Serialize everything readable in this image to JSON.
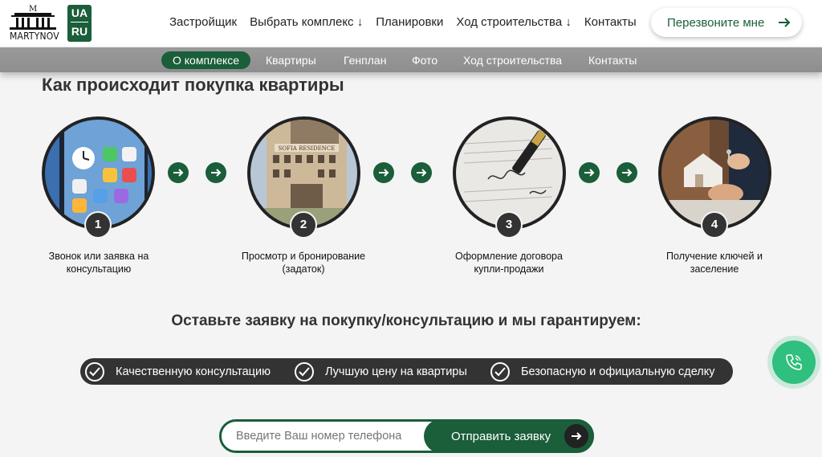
{
  "header": {
    "logo_text": "MARTYNOV",
    "lang": [
      "UA",
      "RU"
    ],
    "nav": [
      "Застройщик",
      "Выбрать комплекс ↓",
      "Планировки",
      "Ход строительства ↓",
      "Контакты"
    ],
    "callback_label": "Перезвоните мне"
  },
  "subnav": [
    "О комплексе",
    "Квартиры",
    "Генплан",
    "Фото",
    "Ход строительства",
    "Контакты"
  ],
  "title": "Как происходит покупка квартиры",
  "steps": [
    {
      "num": "1",
      "label": "Звонок или заявка на консультацию",
      "image": "phone-icon"
    },
    {
      "num": "2",
      "label": "Просмотр и бронирование (задаток)",
      "image": "building-photo",
      "building_sign": "SOFIA RESIDENCE"
    },
    {
      "num": "3",
      "label": "Оформление договора купли-продажи",
      "image": "contract-signing-photo"
    },
    {
      "num": "4",
      "label": "Получение ключей и заселение",
      "image": "keys-handover-photo"
    }
  ],
  "guarantee_title": "Оставьте заявку на покупку/консультацию и мы гарантируем:",
  "guarantees": [
    "Качественную консультацию",
    "Лучшую цену на квартиры",
    "Безопасную и официальную сделку"
  ],
  "form": {
    "placeholder": "Введите Ваш номер телефона",
    "submit_label": "Отправить заявку"
  },
  "colors": {
    "accent": "#1a5e3a",
    "call_button": "#2fbf7e",
    "dark": "#333333"
  }
}
